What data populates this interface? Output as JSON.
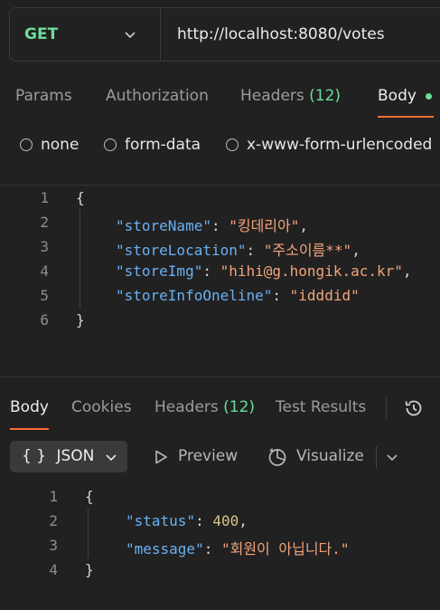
{
  "request": {
    "method": "GET",
    "url": "http://localhost:8080/votes"
  },
  "request_tabs": [
    {
      "label": "Params"
    },
    {
      "label": "Authorization"
    },
    {
      "label": "Headers",
      "count": "(12)"
    },
    {
      "label": "Body",
      "active": true
    }
  ],
  "body_options": [
    "none",
    "form-data",
    "x-www-form-urlencoded"
  ],
  "request_body": {
    "line_numbers": [
      "1",
      "2",
      "3",
      "4",
      "5",
      "6"
    ],
    "open": "{",
    "close": "}",
    "entries": [
      {
        "key": "\"storeName\"",
        "value": "\"킹데리아\"",
        "trail": ","
      },
      {
        "key": "\"storeLocation\"",
        "value": "\"주소이름**\"",
        "trail": ","
      },
      {
        "key": "\"storeImg\"",
        "value": "\"hihi@g.hongik.ac.kr\"",
        "trail": ","
      },
      {
        "key": "\"storeInfoOneline\"",
        "value": "\"idddid\"",
        "trail": ""
      }
    ]
  },
  "response_tabs": [
    {
      "label": "Body",
      "active": true
    },
    {
      "label": "Cookies"
    },
    {
      "label": "Headers",
      "count": "(12)"
    },
    {
      "label": "Test Results"
    }
  ],
  "response_toolbar": {
    "format": "JSON",
    "format_icon": "{ }",
    "preview": "Preview",
    "visualize": "Visualize"
  },
  "response_body": {
    "line_numbers": [
      "1",
      "2",
      "3",
      "4"
    ],
    "open": "{",
    "close": "}",
    "status_key": "\"status\"",
    "status_value": "400",
    "message_key": "\"message\"",
    "message_value": "\"회원이 아닙니다.\""
  },
  "colors": {
    "accent": "#ff6c37",
    "method": "#6bdd9a",
    "json_key": "#6ab0f3",
    "json_string": "#f3a47a",
    "json_number": "#d6c788"
  }
}
